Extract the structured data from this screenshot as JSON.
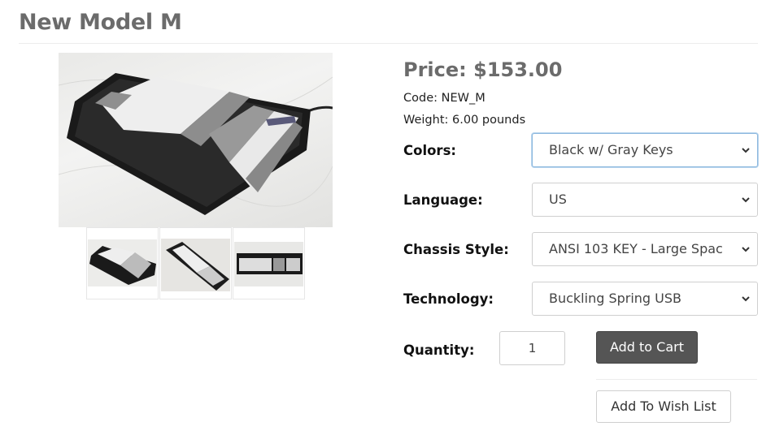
{
  "product": {
    "title": "New Model M",
    "price_label": "Price:",
    "price_value": "$153.00",
    "code_label": "Code:",
    "code_value": "NEW_M",
    "weight_label": "Weight:",
    "weight_value": "6.00 pounds"
  },
  "gallery": {
    "main_image": "keyboard-photo",
    "thumbnails": [
      "keyboard-angle-view",
      "keyboard-side-view",
      "keyboard-top-view"
    ]
  },
  "options": [
    {
      "label": "Colors:",
      "value": "Black w/ Gray Keys"
    },
    {
      "label": "Language:",
      "value": "US"
    },
    {
      "label": "Chassis Style:",
      "value": "ANSI 103 KEY - Large Spac"
    },
    {
      "label": "Technology:",
      "value": "Buckling Spring USB"
    }
  ],
  "quantity": {
    "label": "Quantity:",
    "value": "1"
  },
  "actions": {
    "add_to_cart": "Add to Cart",
    "add_to_wish_list": "Add To Wish List"
  },
  "colors": {
    "title": "#6b6b6b",
    "cart_button": "#555555",
    "focus_border": "#8cb8de"
  }
}
